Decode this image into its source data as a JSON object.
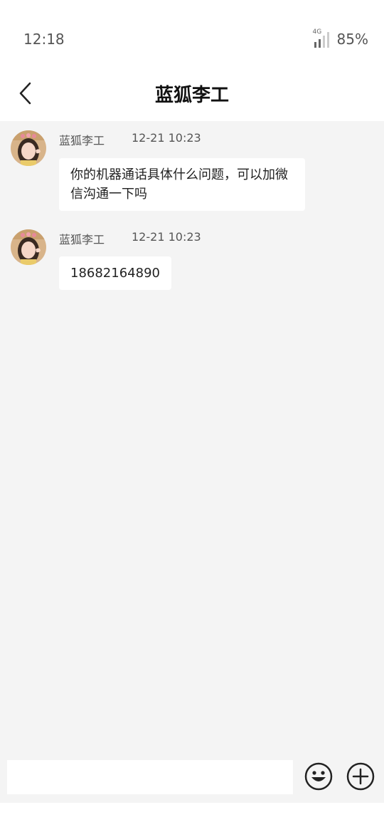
{
  "status_bar": {
    "time": "12:18",
    "network": "4G",
    "battery": "85%"
  },
  "header": {
    "title": "蓝狐李工"
  },
  "messages": [
    {
      "sender": "蓝狐李工",
      "time": "12-21 10:23",
      "text": "你的机器通话具体什么问题，可以加微信沟通一下吗"
    },
    {
      "sender": "蓝狐李工",
      "time": "12-21 10:23",
      "text": "18682164890"
    }
  ],
  "input": {
    "value": "",
    "placeholder": ""
  },
  "icons": {
    "back": "back-arrow-icon",
    "emoji": "emoji-icon",
    "add": "plus-icon"
  }
}
